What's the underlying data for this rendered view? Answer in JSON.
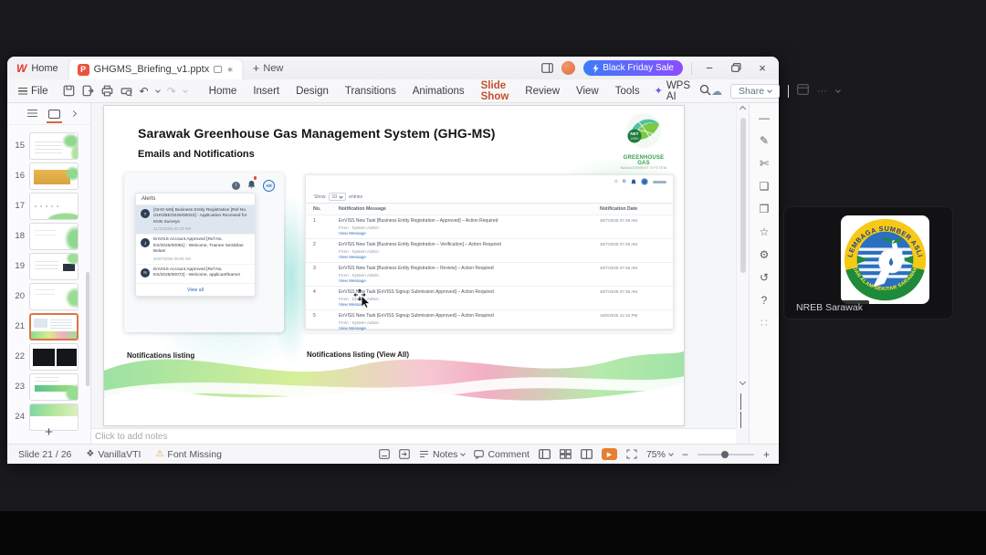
{
  "titlebar": {
    "logo": "W",
    "home_tab": "Home",
    "doc_badge": "P",
    "doc_tab": "GHGMS_Briefing_v1.pptx",
    "new_tab": "New",
    "promo_label": "Black Friday Sale"
  },
  "toolbar": {
    "file_label": "File",
    "menus": [
      {
        "label": "Home"
      },
      {
        "label": "Insert"
      },
      {
        "label": "Design"
      },
      {
        "label": "Transitions"
      },
      {
        "label": "Animations"
      },
      {
        "label": "Slide Show",
        "active": true
      },
      {
        "label": "Review"
      },
      {
        "label": "View"
      },
      {
        "label": "Tools"
      }
    ],
    "wps_ai_label": "WPS AI",
    "share_label": "Share"
  },
  "slide_panel": {
    "slides": [
      {
        "num": "15",
        "variant": "v15"
      },
      {
        "num": "16",
        "variant": "v16"
      },
      {
        "num": "17",
        "variant": "v17"
      },
      {
        "num": "18",
        "variant": "v18"
      },
      {
        "num": "19",
        "variant": "v19"
      },
      {
        "num": "20",
        "variant": "v20"
      },
      {
        "num": "21",
        "variant": "v21",
        "selected": true
      },
      {
        "num": "22",
        "variant": "v22"
      },
      {
        "num": "23",
        "variant": "v23"
      },
      {
        "num": "24",
        "variant": "v24"
      }
    ]
  },
  "slide": {
    "title": "Sarawak Greenhouse Gas Management System (GHG-MS)",
    "subtitle": "Emails and Notifications",
    "logo": {
      "badge_top": "NET",
      "badge_bottom": "2050",
      "name_line1": "GREENHOUSE GAS",
      "name_line2": "MANAGEMENT SYSTEM"
    },
    "caption_left": "Notifications listing",
    "caption_right": "Notifications listing (View All)",
    "alerts": {
      "header": "Alerts",
      "avatar_initials": "AR",
      "items": [
        {
          "initial": "T",
          "text": "[GHG-MS] Business Entity Registration [Ref No. GHG/BE/2025/00023] - Application Received for KNN Surveys",
          "time": "21/10/2025 02:19 PM",
          "highlight": true
        },
        {
          "initial": "J",
          "text": "EnVISS Account Approved [Ref No. ES/2025/00081] - Welcome, Trainee Sembilan Belas!",
          "time": "30/07/2025 09:09 AM"
        },
        {
          "initial": "N",
          "text": "EnVISS Account Approved [Ref No. ES/2025/00072] - Welcome, applicantfname!",
          "time": ""
        }
      ],
      "view_all": "View all"
    },
    "portal": {
      "show_label": "Show",
      "show_value": "10",
      "entries_label": "entries",
      "col_no": "No.",
      "col_message": "Notification Message",
      "col_date": "Notification Date",
      "rows": [
        {
          "no": "1",
          "message": "EnVISS New Task [Business Entity Registration – Approved] – Action Required",
          "from": "From : System Admin",
          "link": "View Message",
          "date": "30/7/2025 07:49 AM"
        },
        {
          "no": "2",
          "message": "EnVISS New Task [Business Entity Registration – Verification] – Action Required",
          "from": "From : System Admin",
          "link": "View Message",
          "date": "30/7/2025 07:48 AM"
        },
        {
          "no": "3",
          "message": "EnVISS New Task [Business Entity Registration – Review] – Action Required",
          "from": "From : System Admin",
          "link": "View Message",
          "date": "30/7/2025 07:46 AM"
        },
        {
          "no": "4",
          "message": "EnVISS New Task [EnVISS Signup Submission Approved] – Action Required",
          "from": "From : System Admin",
          "link": "View Message",
          "date": "30/7/2025 07:30 AM"
        },
        {
          "no": "5",
          "message": "EnVISS New Task [EnVISS Signup Submission Approved] – Action Required",
          "from": "From : System Admin",
          "link": "View Message",
          "date": "16/6/2025 12:10 PM"
        }
      ]
    }
  },
  "notes_placeholder": "Click to add notes",
  "statusbar": {
    "slide_counter": "Slide 21 / 26",
    "theme_name": "VanillaVTI",
    "font_missing": "Font Missing",
    "notes_label": "Notes",
    "comment_label": "Comment",
    "zoom_value": "75%",
    "zoom_minus": "−",
    "zoom_plus": "+"
  },
  "meeting": {
    "participant_name": "NREB Sarawak",
    "logo_arc_top": "LEMBAGA SUMBER ASLI",
    "logo_arc_bottom": "DAN ALAM SEKITAR SARAWAK"
  },
  "icons": {
    "plus": "+",
    "modified": "∗",
    "minimize": "−",
    "close": "×",
    "cloud": "☁",
    "more": "⋯",
    "undo": "↶",
    "redo": "↷",
    "wps_ai_star": "✦",
    "theme_badge": "❖",
    "warning": "⚠",
    "play": "▶",
    "info": "i",
    "home_mini": "⌂",
    "gear_mini": "⚙",
    "rail": [
      {
        "name": "collapse",
        "glyph": "—"
      },
      {
        "name": "format-brush",
        "glyph": "✎"
      },
      {
        "name": "design-tools",
        "glyph": "✄"
      },
      {
        "name": "shapes",
        "glyph": "❏"
      },
      {
        "name": "comment",
        "glyph": "❒"
      },
      {
        "name": "favorites",
        "glyph": "☆"
      },
      {
        "name": "settings",
        "glyph": "⚙"
      },
      {
        "name": "history",
        "glyph": "↺"
      },
      {
        "name": "help",
        "glyph": "?"
      },
      {
        "name": "apps",
        "glyph": "∷"
      }
    ]
  }
}
